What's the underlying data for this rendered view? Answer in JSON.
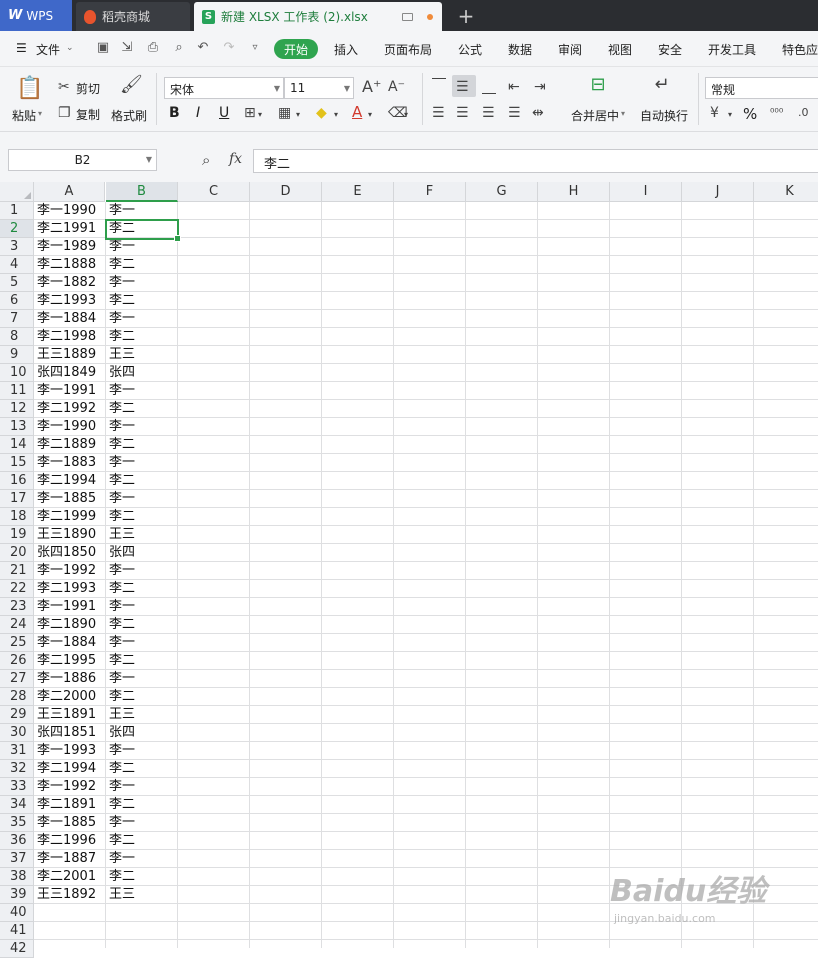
{
  "tabs": {
    "wps": "WPS",
    "daoke": "稻壳商城",
    "doc": "新建 XLSX 工作表 (2).xlsx",
    "add": "+"
  },
  "menu": {
    "file": "文件",
    "items": [
      "开始",
      "插入",
      "页面布局",
      "公式",
      "数据",
      "审阅",
      "视图",
      "安全",
      "开发工具",
      "特色应"
    ]
  },
  "ribbon": {
    "paste": "粘贴",
    "cut": "剪切",
    "copy": "复制",
    "format_painter": "格式刷",
    "font_name": "宋体",
    "font_size": "11",
    "bold": "B",
    "italic": "I",
    "underline": "U",
    "font_color_glyph": "A",
    "merge": "合并居中",
    "wrap": "自动换行",
    "number_format": "常规",
    "percent": "%"
  },
  "formula_bar": {
    "name_box": "B2",
    "fx": "fx",
    "content": "李二"
  },
  "sheet": {
    "columns": [
      "A",
      "B",
      "C",
      "D",
      "E",
      "F",
      "G",
      "H",
      "I",
      "J",
      "K"
    ],
    "row_numbers": [
      "1",
      "2",
      "3",
      "4",
      "5",
      "6",
      "7",
      "8",
      "9",
      "10",
      "11",
      "12",
      "13",
      "14",
      "15",
      "16",
      "17",
      "18",
      "19",
      "20",
      "21",
      "22",
      "23",
      "24",
      "25",
      "26",
      "27",
      "28",
      "29",
      "30",
      "31",
      "32",
      "33",
      "34",
      "35",
      "36",
      "37",
      "38",
      "39",
      "40",
      "41",
      "42"
    ],
    "selected_cell": "B2",
    "rows": [
      [
        "李一1990",
        "李一"
      ],
      [
        "李二1991",
        "李二"
      ],
      [
        "李一1989",
        "李一"
      ],
      [
        "李二1888",
        "李二"
      ],
      [
        "李一1882",
        "李一"
      ],
      [
        "李二1993",
        "李二"
      ],
      [
        "李一1884",
        "李一"
      ],
      [
        "李二1998",
        "李二"
      ],
      [
        "王三1889",
        "王三"
      ],
      [
        "张四1849",
        "张四"
      ],
      [
        "李一1991",
        "李一"
      ],
      [
        "李二1992",
        "李二"
      ],
      [
        "李一1990",
        "李一"
      ],
      [
        "李二1889",
        "李二"
      ],
      [
        "李一1883",
        "李一"
      ],
      [
        "李二1994",
        "李二"
      ],
      [
        "李一1885",
        "李一"
      ],
      [
        "李二1999",
        "李二"
      ],
      [
        "王三1890",
        "王三"
      ],
      [
        "张四1850",
        "张四"
      ],
      [
        "李一1992",
        "李一"
      ],
      [
        "李二1993",
        "李二"
      ],
      [
        "李一1991",
        "李一"
      ],
      [
        "李二1890",
        "李二"
      ],
      [
        "李一1884",
        "李一"
      ],
      [
        "李二1995",
        "李二"
      ],
      [
        "李一1886",
        "李一"
      ],
      [
        "李二2000",
        "李二"
      ],
      [
        "王三1891",
        "王三"
      ],
      [
        "张四1851",
        "张四"
      ],
      [
        "李一1993",
        "李一"
      ],
      [
        "李二1994",
        "李二"
      ],
      [
        "李一1992",
        "李一"
      ],
      [
        "李二1891",
        "李二"
      ],
      [
        "李一1885",
        "李一"
      ],
      [
        "李二1996",
        "李二"
      ],
      [
        "李一1887",
        "李一"
      ],
      [
        "李二2001",
        "李二"
      ],
      [
        "王三1892",
        "王三"
      ]
    ]
  },
  "watermark": {
    "brand": "Baidu经验",
    "url": "jingyan.baidu.com"
  },
  "colors": {
    "accent": "#2fa44f",
    "wps_blue": "#3f68c9",
    "titlebar": "#2b2d31"
  }
}
